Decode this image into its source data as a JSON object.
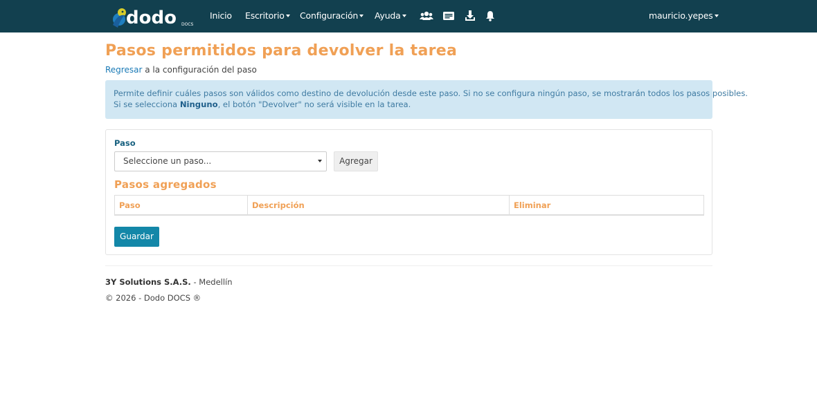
{
  "brand": {
    "logo_text": "dodo",
    "logo_subtext": "DOCS",
    "colors": {
      "navbar": "#12404f",
      "accent_orange": "#f0a055",
      "primary_blue": "#1387a8",
      "link_blue": "#1a7ab6"
    }
  },
  "navbar": {
    "items": [
      {
        "label": "Inicio",
        "dropdown": false
      },
      {
        "label": "Escritorio",
        "dropdown": true
      },
      {
        "label": "Configuración",
        "dropdown": true
      },
      {
        "label": "Ayuda",
        "dropdown": true
      }
    ],
    "icons": [
      "users-icon",
      "id-card-icon",
      "download-icon",
      "bell-icon"
    ],
    "user": {
      "label": "mauricio.yepes",
      "dropdown": true
    }
  },
  "page": {
    "title": "Pasos permitidos para devolver la tarea",
    "back_link": "Regresar",
    "back_suffix": " a la configuración del paso"
  },
  "alert": {
    "line1": "Permite definir cuáles pasos son válidos como destino de devolución desde este paso. Si no se configura ningún paso, se mostrarán todos los pasos posibles.",
    "line2_prefix": "Si se selecciona ",
    "line2_bold": "Ninguno",
    "line2_suffix": ", el botón \"Devolver\" no será visible en la tarea."
  },
  "form": {
    "field_label": "Paso",
    "select_value": "Seleccione un paso...",
    "add_button": "Agregar",
    "section_title": "Pasos agregados",
    "table_headers": [
      "Paso",
      "Descripción",
      "Eliminar"
    ],
    "rows": [],
    "save_button": "Guardar"
  },
  "footer": {
    "company": "3Y Solutions S.A.S.",
    "city_sep": " - Medellín",
    "copyright": "© 2026 - Dodo DOCS ®"
  }
}
